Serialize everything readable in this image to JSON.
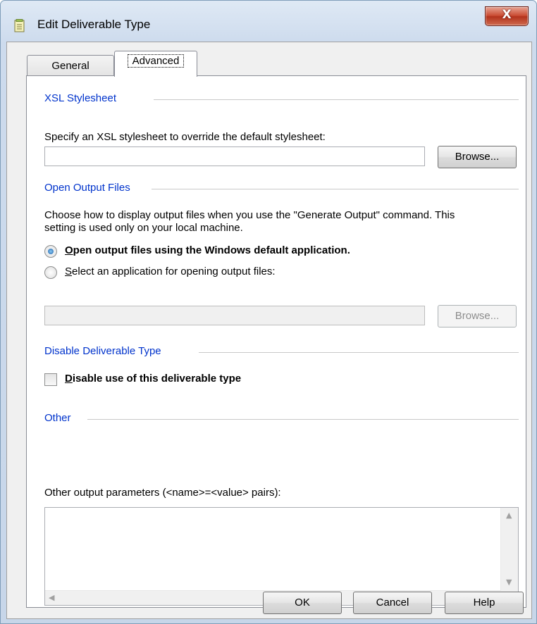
{
  "window": {
    "title": "Edit Deliverable Type",
    "icon": "document-icon",
    "close_glyph": "X"
  },
  "tabs": [
    {
      "label": "General",
      "selected": false
    },
    {
      "label": "Advanced",
      "selected": true
    }
  ],
  "xsl": {
    "heading": "XSL Stylesheet",
    "prompt": "Specify an XSL stylesheet to override the default stylesheet:",
    "value": "",
    "browse_label": "Browse..."
  },
  "output": {
    "heading": "Open Output Files",
    "description_line1": "Choose how to display output files when you use the \"Generate Output\" command. This",
    "description_line2": "setting is used only on your local machine.",
    "option_default": {
      "accel": "O",
      "rest": "pen output files using the Windows default application.",
      "checked": true
    },
    "option_select": {
      "accel": "S",
      "rest": "elect an application for opening output files:",
      "checked": false
    },
    "app_value": "",
    "browse_label": "Browse..."
  },
  "disable": {
    "heading": "Disable Deliverable Type",
    "checkbox": {
      "accel": "D",
      "rest": "isable use of this deliverable type",
      "checked": false
    }
  },
  "other": {
    "heading": "Other",
    "prompt": "Other output parameters (<name>=<value> pairs):",
    "value": ""
  },
  "footer": {
    "ok_label": "OK",
    "cancel_label": "Cancel",
    "help_label": "Help"
  }
}
